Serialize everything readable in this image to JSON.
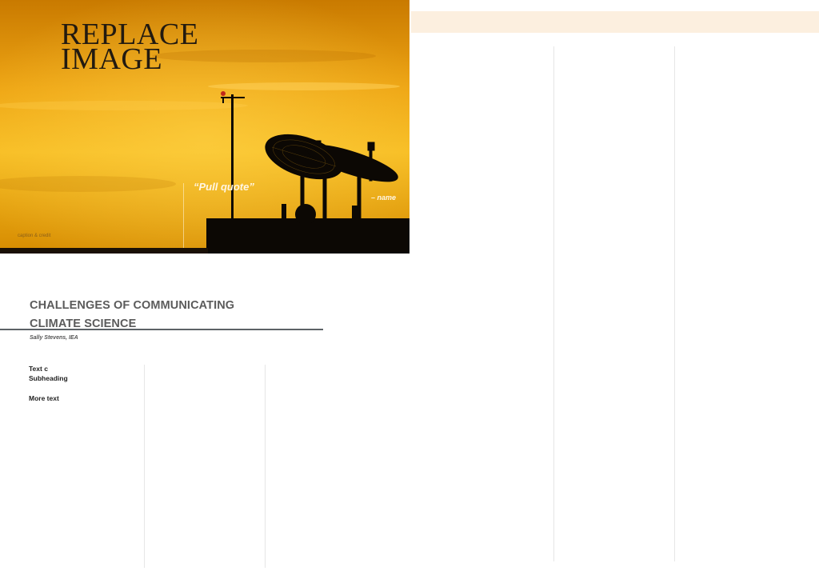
{
  "hero": {
    "title_lines": [
      "REPLACE",
      "IMAGE"
    ],
    "pull_quote": "“Pull quote”",
    "quote_name": "– name",
    "caption": "caption & credit"
  },
  "article": {
    "title_lines": [
      "CHALLENGES OF COMMUNICATING",
      "CLIMATE SCIENCE"
    ],
    "byline": "Sally Stevens, IEA",
    "body": {
      "line1": "Text c",
      "subheading": "Subheading",
      "more_text": "More text"
    }
  },
  "colors": {
    "sky_top": "#d98a00",
    "sky_mid": "#f4b81c",
    "sky_bottom": "#c88000",
    "silhouette": "#0c0804",
    "title_text": "#5b5b5b",
    "rule": "#5c6266",
    "band": "#fcefdf"
  },
  "icons": {
    "hero_image": "satellite-dishes-sunset-photo"
  }
}
